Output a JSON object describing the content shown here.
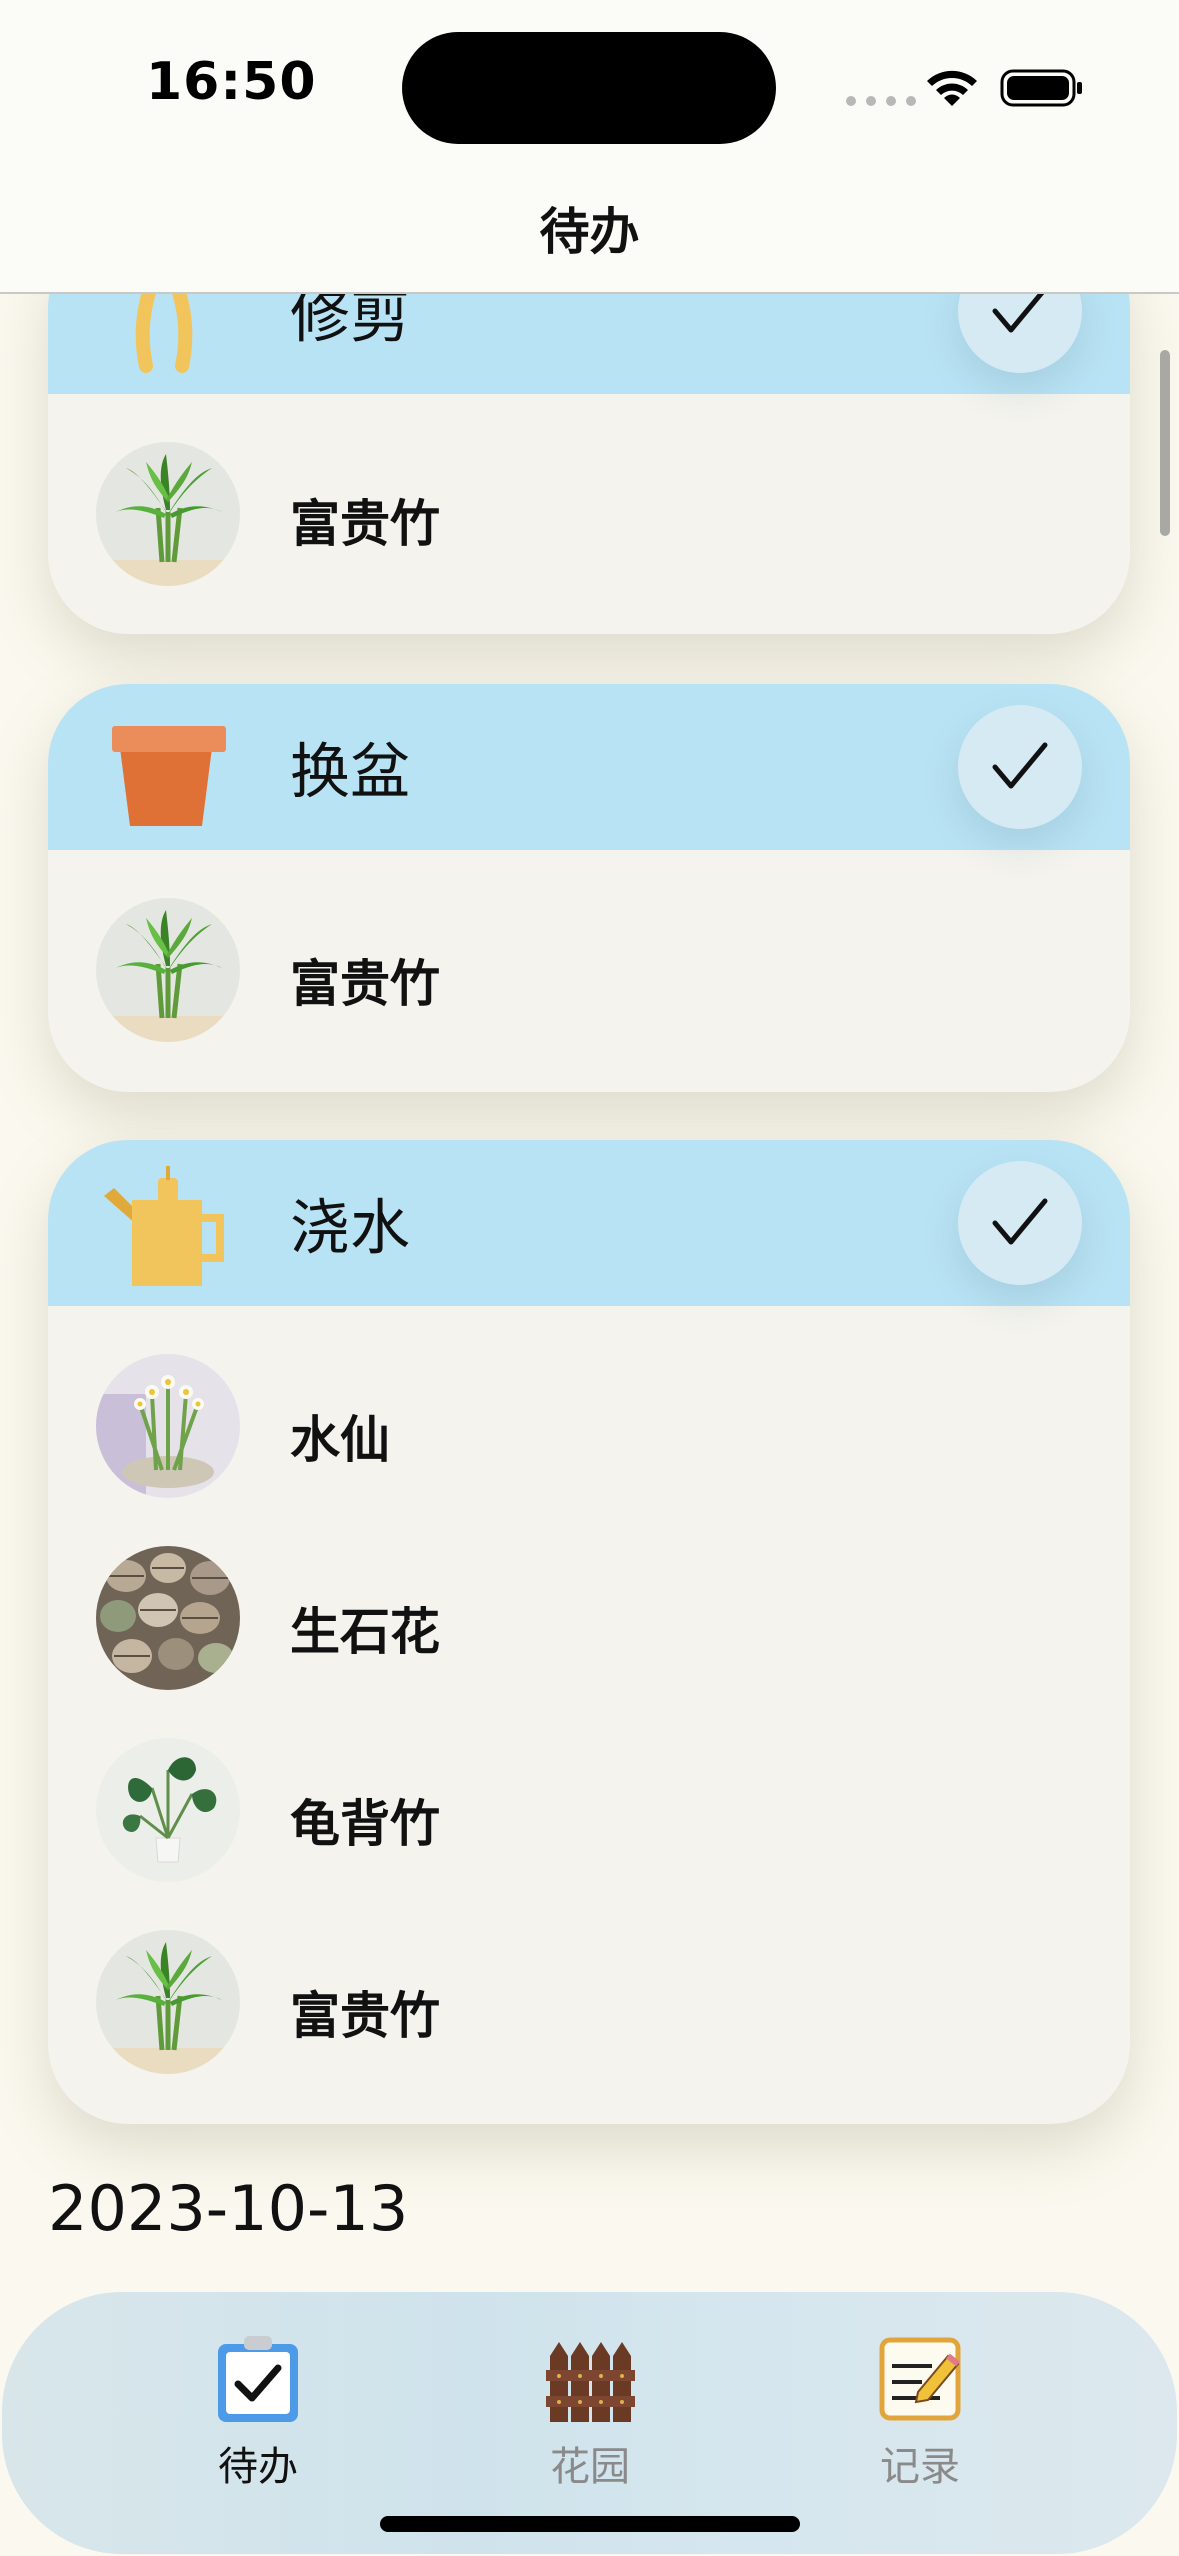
{
  "status_bar": {
    "time": "16:50"
  },
  "nav": {
    "title": "待办"
  },
  "tasks": [
    {
      "title": "修剪",
      "icon": "pruning-shears-icon",
      "plants": [
        {
          "name": "富贵竹",
          "photo": "lucky-bamboo-photo"
        }
      ]
    },
    {
      "title": "换盆",
      "icon": "flower-pot-icon",
      "plants": [
        {
          "name": "富贵竹",
          "photo": "lucky-bamboo-photo"
        }
      ]
    },
    {
      "title": "浇水",
      "icon": "watering-can-icon",
      "plants": [
        {
          "name": "水仙",
          "photo": "narcissus-photo"
        },
        {
          "name": "生石花",
          "photo": "lithops-photo"
        },
        {
          "name": "龟背竹",
          "photo": "monstera-photo"
        },
        {
          "name": "富贵竹",
          "photo": "lucky-bamboo-photo"
        }
      ]
    }
  ],
  "next_date": "2023-10-13",
  "tabbar": {
    "tabs": [
      {
        "label": "待办",
        "icon": "todo-clipboard-icon",
        "active": true
      },
      {
        "label": "花园",
        "icon": "garden-fence-icon",
        "active": false
      },
      {
        "label": "记录",
        "icon": "record-notepad-icon",
        "active": false
      }
    ]
  },
  "colors": {
    "background": "#fbf9ef",
    "card_header": "#b8e3f4",
    "card_body": "#f4f3ee",
    "check_button": "#d5eaf3",
    "tab_inactive_label": "#8a8a8a"
  }
}
